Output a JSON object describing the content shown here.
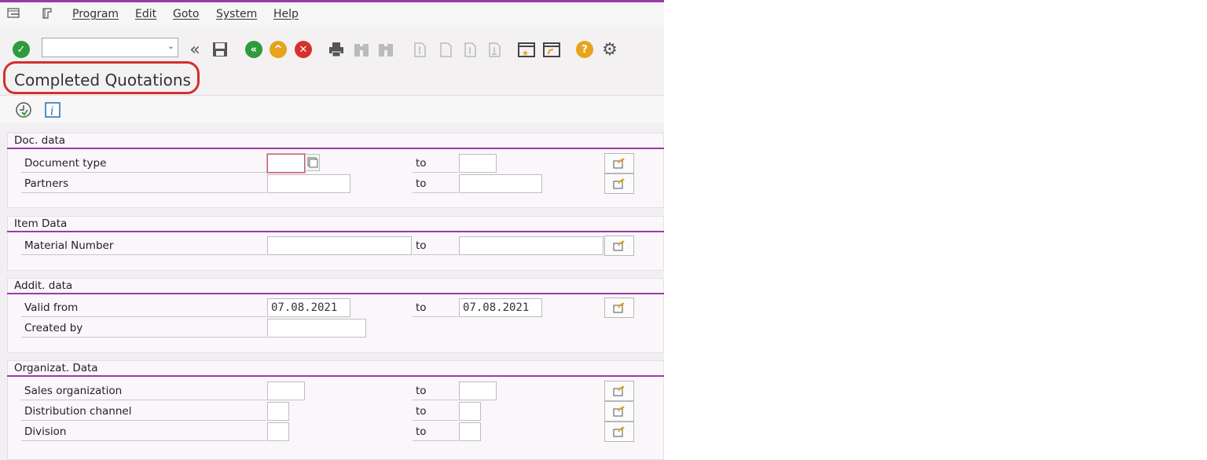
{
  "menu": {
    "items": [
      "Program",
      "Edit",
      "Goto",
      "System",
      "Help"
    ],
    "icons": [
      "menu-exit-icon",
      "menu-tcode-icon"
    ]
  },
  "toolbar": {
    "command_value": "",
    "icons": [
      "enter-icon",
      "back-double-icon",
      "save-icon",
      "back-icon",
      "exit-icon",
      "cancel-icon",
      "print-icon",
      "find-icon",
      "find-next-icon",
      "first-page-icon",
      "previous-page-icon",
      "next-page-icon",
      "last-page-icon",
      "create-session-icon",
      "shortcut-icon",
      "help-icon",
      "customize-icon"
    ],
    "colors": {
      "enter": "#2e9b3c",
      "back": "#2e9b3c",
      "exit": "#e8a31c",
      "cancel": "#d8302b",
      "help": "#e8a31c"
    }
  },
  "title": "Completed Quotations",
  "app_toolbar": {
    "icons": [
      "execute-icon",
      "info-icon"
    ]
  },
  "groups": [
    {
      "heading": "Doc. data",
      "rows": [
        {
          "label": "Document type",
          "from": "",
          "to_label": "to",
          "to": ""
        },
        {
          "label": "Partners",
          "from": "",
          "to_label": "to",
          "to": ""
        }
      ]
    },
    {
      "heading": "Item Data",
      "rows": [
        {
          "label": "Material Number",
          "from": "",
          "to_label": "to",
          "to": ""
        }
      ]
    },
    {
      "heading": "Addit. data",
      "rows": [
        {
          "label": "Valid from",
          "from": "07.08.2021",
          "to_label": "to",
          "to": "07.08.2021"
        },
        {
          "label": "Created by",
          "from": ""
        }
      ]
    },
    {
      "heading": "Organizat. Data",
      "rows": [
        {
          "label": "Sales organization",
          "from": "",
          "to_label": "to",
          "to": ""
        },
        {
          "label": "Distribution channel",
          "from": "",
          "to_label": "to",
          "to": ""
        },
        {
          "label": "Division",
          "from": "",
          "to_label": "to",
          "to": ""
        }
      ]
    }
  ],
  "accent_color": "#9b3aa6",
  "highlight_color": "#d32f2f"
}
